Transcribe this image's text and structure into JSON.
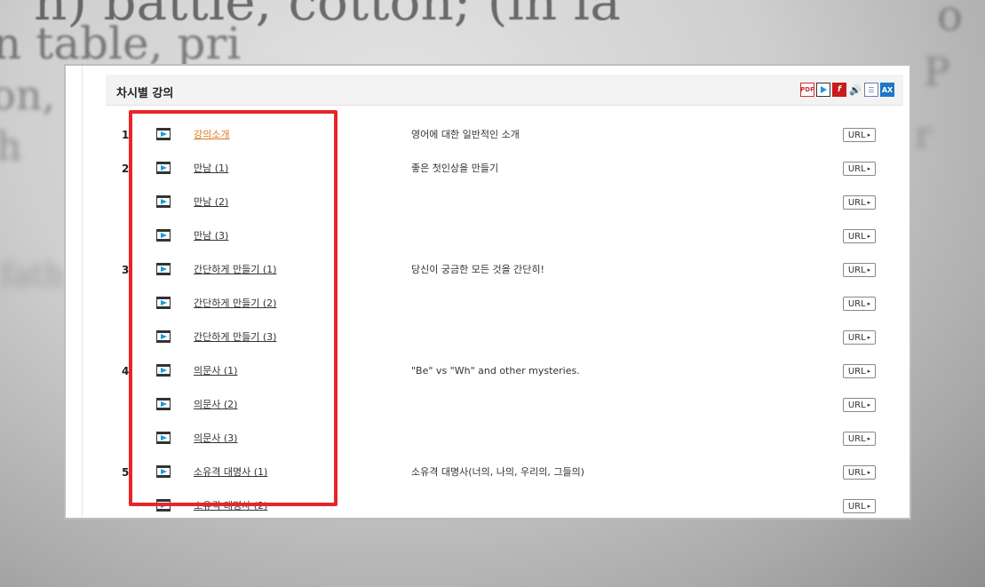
{
  "section": {
    "title": "차시별 강의"
  },
  "format_icons": [
    "pdf-icon",
    "video-icon",
    "flash-icon",
    "audio-icon",
    "document-icon",
    "ax-icon"
  ],
  "rows": [
    {
      "num": "1.",
      "title": "강의소개",
      "desc": "영어에 대한 일반적인 소개",
      "url": "URL"
    },
    {
      "num": "2.",
      "title": "만남 (1)",
      "desc": "좋은 첫인상을 만들기",
      "url": "URL"
    },
    {
      "num": "",
      "title": "만남 (2)",
      "desc": "",
      "url": "URL"
    },
    {
      "num": "",
      "title": "만남 (3)",
      "desc": "",
      "url": "URL"
    },
    {
      "num": "3.",
      "title": "간단하게 만들기 (1)",
      "desc": "당신이 궁금한 모든 것을 간단히!",
      "url": "URL"
    },
    {
      "num": "",
      "title": "간단하게 만들기 (2)",
      "desc": "",
      "url": "URL"
    },
    {
      "num": "",
      "title": "간단하게 만들기 (3)",
      "desc": "",
      "url": "URL"
    },
    {
      "num": "4.",
      "title": "의문사 (1)",
      "desc": "\"Be\" vs \"Wh\" and other mysteries.",
      "url": "URL"
    },
    {
      "num": "",
      "title": "의문사 (2)",
      "desc": "",
      "url": "URL"
    },
    {
      "num": "",
      "title": "의문사 (3)",
      "desc": "",
      "url": "URL"
    },
    {
      "num": "5.",
      "title": "소유격 대명사 (1)",
      "desc": "소유격 대명사(너의, 나의, 우리의, 그들의)",
      "url": "URL"
    },
    {
      "num": "",
      "title": "소유격 대명사 (2)",
      "desc": "",
      "url": "URL"
    }
  ],
  "background_text": [
    "n) battle, cotton; (in la",
    "n table, pri",
    "on, i",
    "h",
    "fath",
    "o",
    "P",
    "r"
  ],
  "colors": {
    "highlight": "#e8252a",
    "active_link": "#e07a24",
    "header_bg": "#f3f3f3"
  }
}
